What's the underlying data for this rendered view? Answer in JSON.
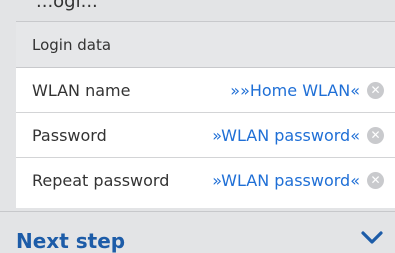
{
  "top_fragment": "...ogi...",
  "login_data": {
    "title": "Login data",
    "rows": [
      {
        "label": "WLAN name",
        "value": "»»Home WLAN«",
        "icon": "clear-icon"
      },
      {
        "label": "Password",
        "value": "»WLAN password«",
        "icon": "clear-icon"
      },
      {
        "label": "Repeat password",
        "value": "»WLAN password«",
        "icon": "clear-icon"
      }
    ]
  },
  "footer": {
    "next_step_label": "Next step",
    "icon": "chevron-down-icon"
  },
  "colors": {
    "accent": "#1f6fd6",
    "heading_blue": "#1d5ca8",
    "background": "#e3e4e6"
  }
}
